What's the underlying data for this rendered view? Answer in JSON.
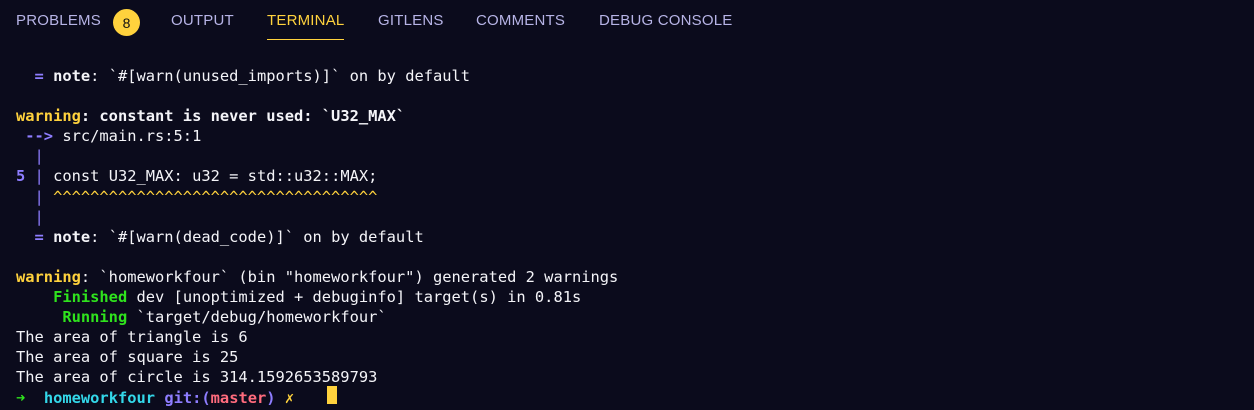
{
  "tabs": [
    {
      "label": "PROBLEMS",
      "badge": "8"
    },
    {
      "label": "OUTPUT"
    },
    {
      "label": "TERMINAL"
    },
    {
      "label": "GITLENS"
    },
    {
      "label": "COMMENTS"
    },
    {
      "label": "DEBUG CONSOLE"
    }
  ],
  "terminal": {
    "note1": {
      "prefix": "  = ",
      "label": "note",
      "text": ": `#[warn(unused_imports)]` on by default"
    },
    "warning1": {
      "label": "warning",
      "text": ": constant is never used: `U32_MAX`"
    },
    "arrow": {
      "arrow": " --> ",
      "location": "src/main.rs:5:1"
    },
    "gutter1": "  |",
    "code_line": {
      "line_number": "5",
      "sep": " | ",
      "code": "const U32_MAX: u32 = std::u32::MAX;"
    },
    "caret_line": {
      "gutter": "  |",
      "carets": " ^^^^^^^^^^^^^^^^^^^^^^^^^^^^^^^^^^^"
    },
    "gutter2": "  |",
    "note2": {
      "prefix": "  = ",
      "label": "note",
      "text": ": `#[warn(dead_code)]` on by default"
    },
    "warning2": {
      "label": "warning",
      "text": ": `homeworkfour` (bin \"homeworkfour\") generated 2 warnings"
    },
    "finished": {
      "indent": "    ",
      "label": "Finished",
      "text": " dev [unoptimized + debuginfo] target(s) in 0.81s"
    },
    "running": {
      "indent": "     ",
      "label": "Running",
      "text": " `target/debug/homeworkfour`"
    },
    "output": [
      "The area of triangle is 6",
      "The area of square is 25",
      "The area of circle is 314.1592653589793"
    ],
    "prompt": {
      "arrow": "➜",
      "dir": "homeworkfour",
      "git_open": "git:(",
      "branch": "master",
      "git_close": ")",
      "dirty": "✗"
    }
  },
  "colors": {
    "background": "#0b0b1c",
    "accent_yellow": "#ffd23d",
    "tab_text": "#b7b4e6",
    "purple": "#8e7dff",
    "green": "#2fe31d",
    "cyan": "#33d8ea",
    "branch_red": "#ff6b7d"
  }
}
